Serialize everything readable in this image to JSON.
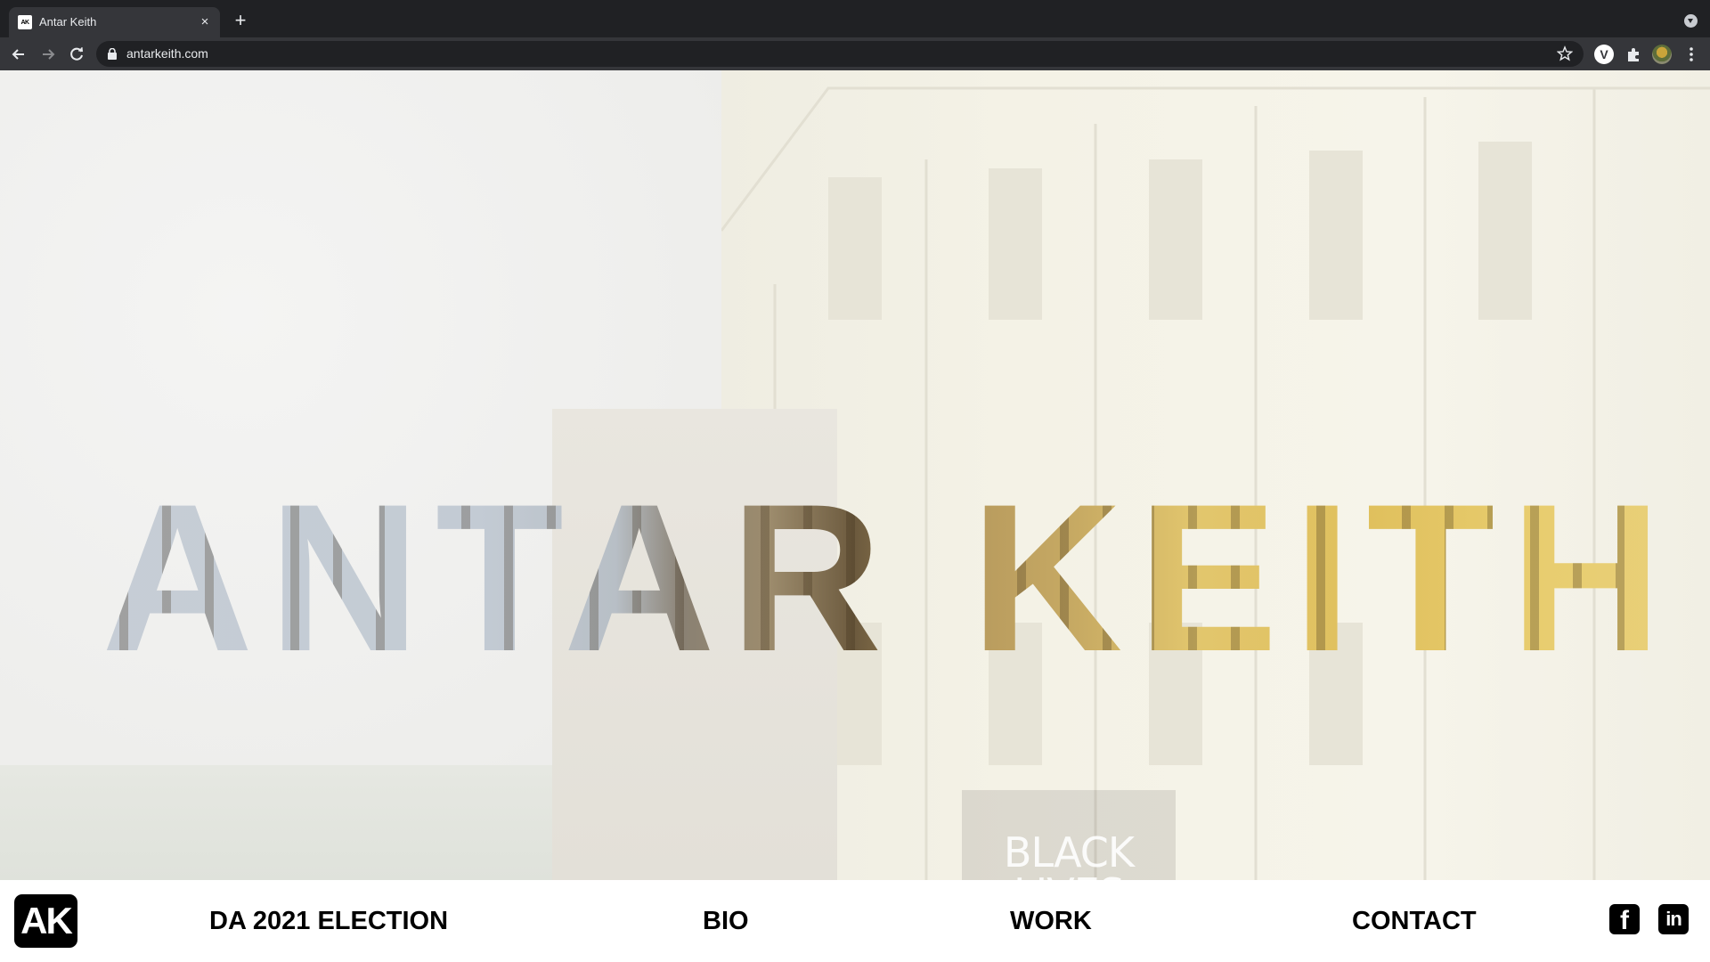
{
  "browser": {
    "tab_title": "Antar Keith",
    "favicon_text": "AK",
    "tab_close": "×",
    "new_tab": "+",
    "url": "antarkeith.com",
    "extension_v": "V"
  },
  "hero": {
    "name": "ANTAR KEITH",
    "background_sign": "BLACK LIVES MATTER"
  },
  "footer": {
    "logo": "AK",
    "nav": [
      "DA 2021 ELECTION",
      "BIO",
      "WORK",
      "CONTACT"
    ],
    "social": {
      "facebook": "f",
      "linkedin": "in"
    }
  },
  "colors": {
    "chrome_dark": "#202124",
    "chrome_toolbar": "#35363a",
    "text_dark": "#000000",
    "accent_gold": "#e2c66d"
  }
}
